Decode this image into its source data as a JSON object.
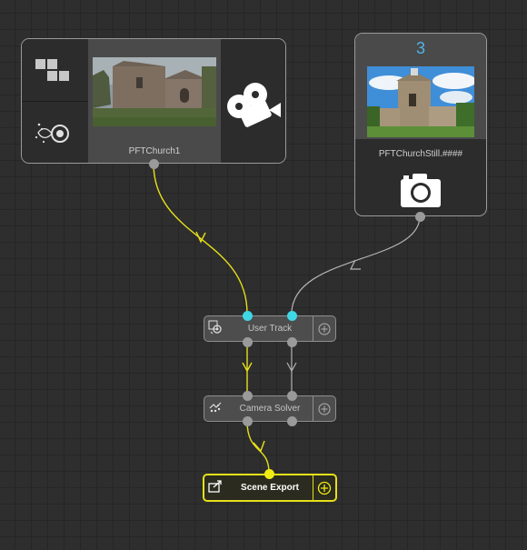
{
  "colors": {
    "canvas": "#2e2e2e",
    "grid": "#262626",
    "active_wire": "#e6e01a",
    "inactive_wire": "#b4b4b4",
    "input_port": "#3fd6e6",
    "frame_number": "#4fb3e6"
  },
  "nodes": {
    "clip": {
      "label": "PFTChurch1",
      "left_icons": [
        "grid-blocks-icon",
        "tracking-target-icon"
      ],
      "right_icon": "video-camera-icon"
    },
    "still": {
      "frame_number": "3",
      "label": "PFTChurchStill.####",
      "icon": "photo-camera-icon"
    },
    "user_track": {
      "label": "User Track",
      "icon": "user-track-icon",
      "add_icon": "add-circle-icon"
    },
    "camera_solver": {
      "label": "Camera Solver",
      "icon": "camera-solver-icon",
      "add_icon": "add-circle-icon"
    },
    "scene_export": {
      "label": "Scene Export",
      "icon": "export-icon",
      "add_icon": "add-circle-icon"
    }
  },
  "connections": [
    {
      "from": "PFTChurch1",
      "to": "User Track",
      "state": "active"
    },
    {
      "from": "PFTChurchStill.####",
      "to": "User Track",
      "state": "inactive"
    },
    {
      "from": "User Track",
      "to": "Camera Solver",
      "state": "active"
    },
    {
      "from": "User Track",
      "to": "Camera Solver",
      "state": "inactive"
    },
    {
      "from": "Camera Solver",
      "to": "Scene Export",
      "state": "active"
    }
  ]
}
